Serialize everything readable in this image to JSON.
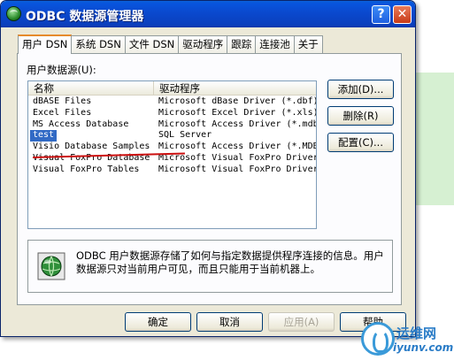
{
  "window": {
    "title": "ODBC 数据源管理器",
    "help_button": "?",
    "close_button": "✕"
  },
  "tabs": [
    {
      "label": "用户 DSN",
      "active": true
    },
    {
      "label": "系统 DSN",
      "active": false
    },
    {
      "label": "文件 DSN",
      "active": false
    },
    {
      "label": "驱动程序",
      "active": false
    },
    {
      "label": "跟踪",
      "active": false
    },
    {
      "label": "连接池",
      "active": false
    },
    {
      "label": "关于",
      "active": false
    }
  ],
  "datasources": {
    "label": "用户数据源(U):",
    "columns": [
      "名称",
      "驱动程序"
    ],
    "rows": [
      {
        "name": "dBASE Files",
        "driver": "Microsoft dBase Driver (*.dbf)",
        "selected": false
      },
      {
        "name": "Excel Files",
        "driver": "Microsoft Excel Driver (*.xls)",
        "selected": false
      },
      {
        "name": "MS Access Database",
        "driver": "Microsoft Access Driver (*.mdb)",
        "selected": false
      },
      {
        "name": "test",
        "driver": "SQL Server",
        "selected": true
      },
      {
        "name": "Visio Database Samples",
        "driver": "Microsoft Access Driver (*.MDB)",
        "selected": false
      },
      {
        "name": "Visual FoxPro Database",
        "driver": "Microsoft Visual FoxPro Driver",
        "selected": false
      },
      {
        "name": "Visual FoxPro Tables",
        "driver": "Microsoft Visual FoxPro Driver",
        "selected": false
      }
    ]
  },
  "side_buttons": {
    "add": "添加(D)...",
    "remove": "删除(R)",
    "configure": "配置(C)..."
  },
  "info": {
    "text": "ODBC 用户数据源存储了如何与指定数据提供程序连接的信息。用户数据源只对当前用户可见，而且只能用于当前机器上。"
  },
  "bottom_buttons": {
    "ok": "确定",
    "cancel": "取消",
    "apply": "应用(A)",
    "help": "帮助"
  },
  "watermark": {
    "text1": "运维网",
    "text2": "iyunv.com"
  },
  "colors": {
    "titlebar": "#0a4ad0",
    "selection": "#316ac5",
    "annotation_line": "#cc1010",
    "active_tab_accent": "#e68b2c"
  }
}
